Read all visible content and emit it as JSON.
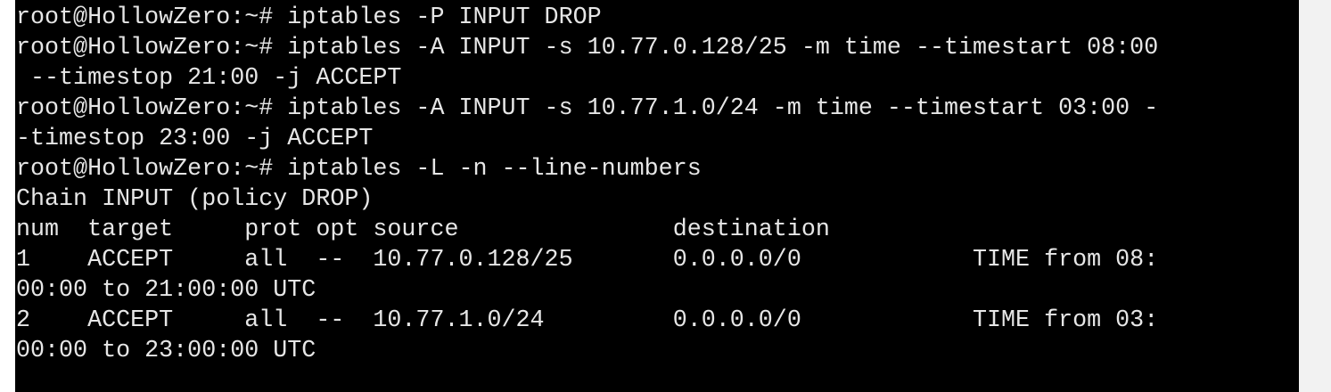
{
  "terminal": {
    "lines": [
      "root@HollowZero:~# iptables -P INPUT DROP",
      "root@HollowZero:~# iptables -A INPUT -s 10.77.0.128/25 -m time --timestart 08:00",
      " --timestop 21:00 -j ACCEPT",
      "root@HollowZero:~# iptables -A INPUT -s 10.77.1.0/24 -m time --timestart 03:00 -",
      "-timestop 23:00 -j ACCEPT",
      "root@HollowZero:~# iptables -L -n --line-numbers",
      "Chain INPUT (policy DROP)",
      "num  target     prot opt source               destination",
      "1    ACCEPT     all  --  10.77.0.128/25       0.0.0.0/0            TIME from 08:",
      "00:00 to 21:00:00 UTC",
      "2    ACCEPT     all  --  10.77.1.0/24         0.0.0.0/0            TIME from 03:",
      "00:00 to 23:00:00 UTC"
    ]
  },
  "colors": {
    "background": "#000000",
    "foreground": "#e6e6e6",
    "page": "#ffffff"
  }
}
